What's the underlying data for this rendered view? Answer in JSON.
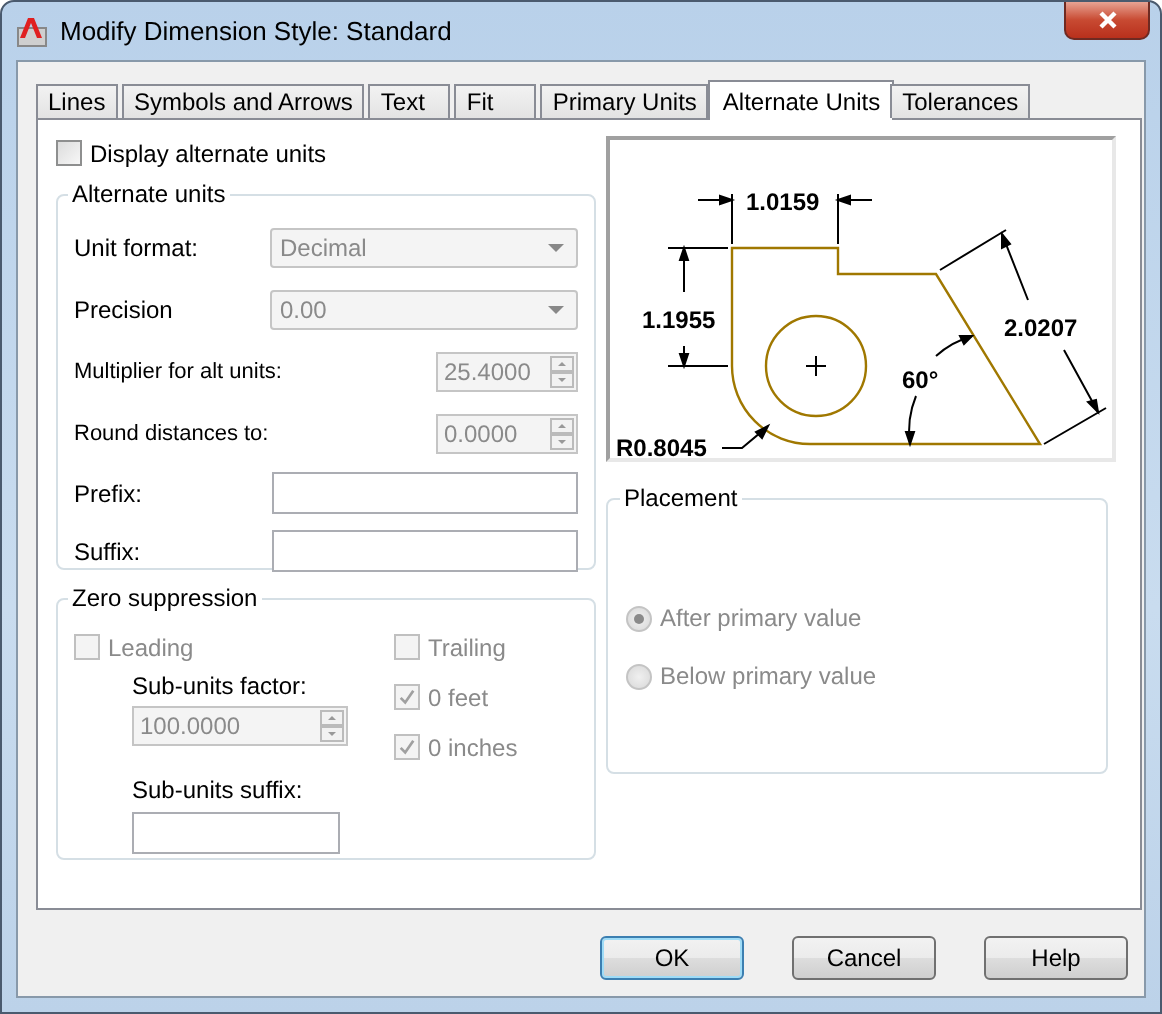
{
  "window": {
    "title": "Modify Dimension Style: Standard"
  },
  "tabs": [
    {
      "label": "Lines",
      "selected": false
    },
    {
      "label": "Symbols and Arrows",
      "selected": false
    },
    {
      "label": "Text",
      "selected": false
    },
    {
      "label": "Fit",
      "selected": false
    },
    {
      "label": "Primary Units",
      "selected": false
    },
    {
      "label": "Alternate Units",
      "selected": true
    },
    {
      "label": "Tolerances",
      "selected": false
    }
  ],
  "display_alternate_units": {
    "label": "Display alternate units",
    "checked": false
  },
  "alternate_units": {
    "title": "Alternate units",
    "fields": [
      {
        "kind": "dropdown",
        "label": "Unit format:",
        "value": "Decimal",
        "disabled": true
      },
      {
        "kind": "dropdown",
        "label": "Precision",
        "value": "0.00",
        "disabled": true
      },
      {
        "kind": "spinner",
        "label": "Multiplier for alt units:",
        "value": "25.4000",
        "disabled": true
      },
      {
        "kind": "spinner",
        "label": "Round distances  to:",
        "value": "0.0000",
        "disabled": true
      },
      {
        "kind": "text",
        "label": "Prefix:",
        "disabled": false
      },
      {
        "kind": "text",
        "label": "Suffix:",
        "disabled": false
      }
    ]
  },
  "zero_suppression": {
    "title": "Zero suppression",
    "leading": {
      "label": "Leading",
      "checked": false,
      "disabled": true
    },
    "sub_units_factor": {
      "label": "Sub-units factor:",
      "value": "100.0000",
      "disabled": true
    },
    "sub_units_suffix": {
      "label": "Sub-units suffix:"
    },
    "trailing": {
      "label": "Trailing",
      "checked": false,
      "disabled": true
    },
    "feet": {
      "label": "0 feet",
      "checked": true,
      "disabled": true
    },
    "inches": {
      "label": "0 inches",
      "checked": true,
      "disabled": true
    }
  },
  "preview": {
    "top_dimension": "1.0159",
    "left_dimension": "1.1955",
    "slant_dimension": "2.0207",
    "angle": "60°",
    "radius": "R0.8045"
  },
  "placement": {
    "title": "Placement",
    "options": [
      {
        "label": "After primary value",
        "selected": true,
        "disabled": true
      },
      {
        "label": "Below primary value",
        "selected": false,
        "disabled": true
      }
    ]
  },
  "buttons": [
    {
      "label": "OK",
      "default": true
    },
    {
      "label": "Cancel",
      "default": false
    },
    {
      "label": "Help",
      "default": false
    }
  ]
}
